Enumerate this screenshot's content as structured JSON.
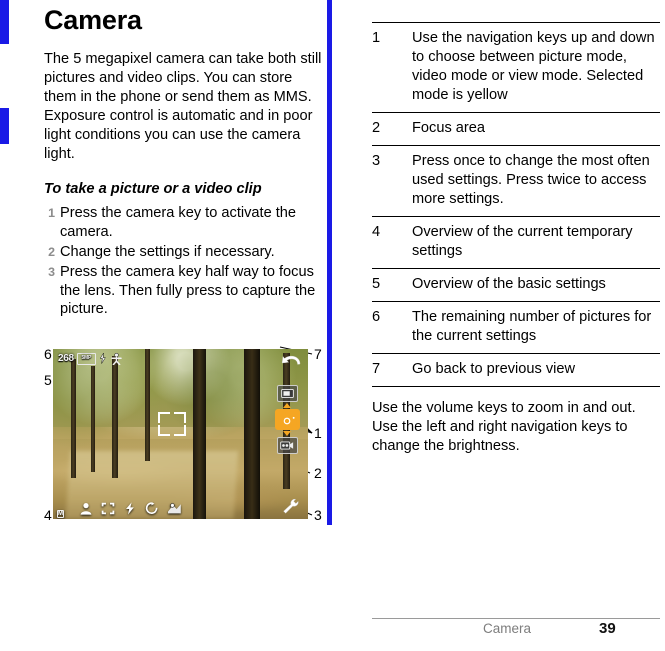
{
  "document": {
    "title": "Camera",
    "footer": {
      "chapter": "Camera",
      "page_number": "39"
    }
  },
  "left_column": {
    "heading": "Camera",
    "intro": "The 5 megapixel camera can take both still pictures and video clips. You can store them in the phone or send them as MMS. Exposure control is automatic and in poor light conditions you can use the camera light.",
    "procedure_heading": "To take a picture or a video clip",
    "steps": [
      {
        "num": "1",
        "text": "Press the camera key to activate the camera."
      },
      {
        "num": "2",
        "text": "Change the settings if necessary."
      },
      {
        "num": "3",
        "text": "Press the camera key half way to focus the lens. Then fully press to capture the picture."
      }
    ]
  },
  "figure": {
    "callouts": [
      "1",
      "2",
      "3",
      "4",
      "5",
      "6",
      "7"
    ],
    "camera_ui": {
      "remaining_pictures": "268",
      "resolution_label": "5MP",
      "shoot_mode_label": "M",
      "status_icons": [
        "picture-count",
        "resolution-5mp",
        "camera-light-icon",
        "self-timer-person-icon"
      ],
      "mode_selector": [
        {
          "name": "view-mode-icon",
          "selected": false
        },
        {
          "name": "picture-mode-icon",
          "selected": true
        },
        {
          "name": "video-mode-icon",
          "selected": false
        }
      ],
      "selected_mode_color": "#f5a623",
      "toolbar_icons": [
        "shoot-mode-icon",
        "scene-portrait-icon",
        "focus-icon",
        "flash-icon",
        "self-timer-icon",
        "white-balance-icon"
      ],
      "focus_area_icon": "focus-brackets-icon",
      "settings_icon": "wrench-settings-icon",
      "back_icon": "back-arrow-icon"
    }
  },
  "right_column": {
    "reference_rows": [
      {
        "num": "1",
        "text": "Use the navigation keys up and down to choose between picture mode, video mode or view mode. Selected mode is yellow"
      },
      {
        "num": "2",
        "text": "Focus area"
      },
      {
        "num": "3",
        "text": "Press once to change the most often used settings. Press twice to access more settings."
      },
      {
        "num": "4",
        "text": "Overview of the current temporary settings"
      },
      {
        "num": "5",
        "text": "Overview of the basic settings"
      },
      {
        "num": "6",
        "text": "The remaining number of pictures for the current settings"
      },
      {
        "num": "7",
        "text": "Go back to previous view"
      }
    ],
    "closing_paragraph": "Use the volume keys to zoom in and out. Use the left and right navigation keys to change the brightness."
  },
  "colors": {
    "accent_blue": "#1a1ae6",
    "selected_mode_yellow": "#f5a623",
    "step_number_gray": "#8c8c8c"
  }
}
